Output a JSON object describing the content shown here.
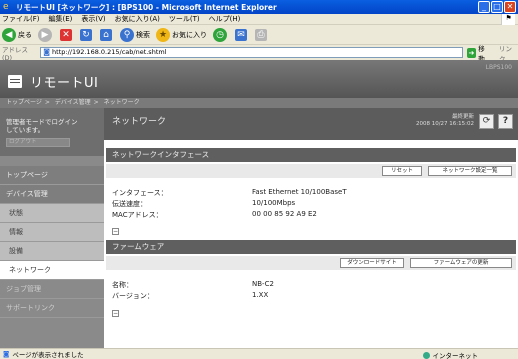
{
  "window": {
    "title": "リモートUI [ネットワーク] : [BPS100 - Microsoft Internet Explorer",
    "controls": {
      "minimize": "_",
      "maximize": "□",
      "close": "✕"
    }
  },
  "menu": [
    "ファイル(F)",
    "編集(E)",
    "表示(V)",
    "お気に入り(A)",
    "ツール(T)",
    "ヘルプ(H)"
  ],
  "toolbar": {
    "back": "戻る",
    "search": "検索",
    "favorites": "お気に入り"
  },
  "address": {
    "label": "アドレス(D)",
    "url": "http://192.168.0.215/cab/net.shtml",
    "go": "移動",
    "links": "リンク"
  },
  "header": {
    "brand": "リモートUI",
    "model": "LBPS100",
    "breadcrumb": [
      "トップページ",
      "デバイス管理",
      "ネットワーク"
    ]
  },
  "pagehead": {
    "title": "ネットワーク",
    "updated_label": "最終更新",
    "updated_time": "2008 10/27 16:15:02",
    "refresh_icon": "⟳",
    "help_icon": "?"
  },
  "sidebar": {
    "login_text_line1": "管理者モードでログイン",
    "login_text_line2": "しています。",
    "logout": "ログアウト",
    "items": [
      {
        "label": "トップページ",
        "type": "section"
      },
      {
        "label": "デバイス管理",
        "type": "section"
      },
      {
        "label": "状態",
        "type": "sub"
      },
      {
        "label": "情報",
        "type": "sub"
      },
      {
        "label": "設備",
        "type": "sub"
      },
      {
        "label": "ネットワーク",
        "type": "active"
      },
      {
        "label": "ジョブ管理",
        "type": "dim"
      },
      {
        "label": "サポートリンク",
        "type": "dim"
      }
    ]
  },
  "network_interface": {
    "heading": "ネットワークインタフェース",
    "reset_button": "リセット",
    "settings_button": "ネットワーク設定一覧",
    "rows": [
      {
        "key": "インタフェース：",
        "value": "Fast Ethernet 10/100BaseT"
      },
      {
        "key": "伝送速度：",
        "value": "10/100Mbps"
      },
      {
        "key": "MACアドレス：",
        "value": "00 00 85 92 A9 E2"
      }
    ]
  },
  "firmware": {
    "heading": "ファームウェア",
    "download_button": "ダウンロードサイト",
    "update_button": "ファームウェアの更新",
    "rows": [
      {
        "key": "名称：",
        "value": "NB-C2"
      },
      {
        "key": "バージョン：",
        "value": "1.XX"
      }
    ]
  },
  "collapse_icon": "−",
  "status": {
    "text": "ページが表示されました",
    "zone": "インターネット"
  }
}
